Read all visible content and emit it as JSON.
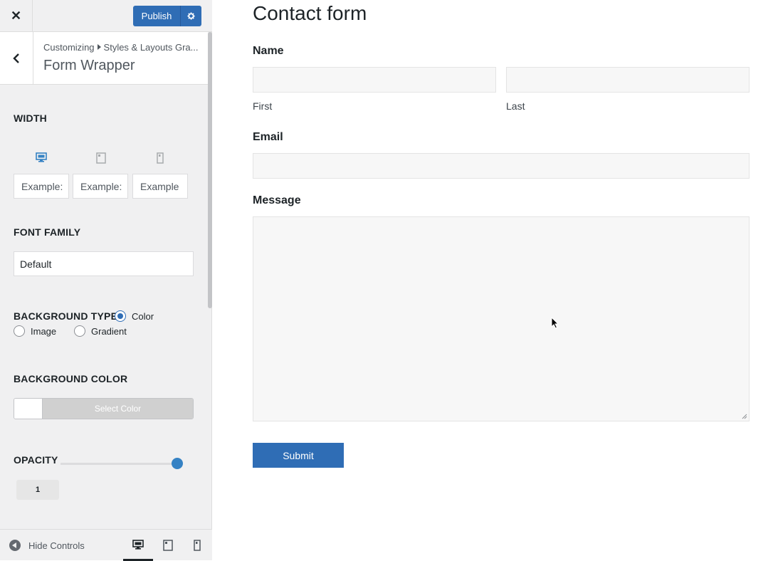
{
  "topbar": {
    "close_label": "✕",
    "publish_label": "Publish"
  },
  "header": {
    "breadcrumb_root": "Customizing",
    "breadcrumb_child": "Styles & Layouts Gra...",
    "title": "Form Wrapper"
  },
  "width": {
    "label": "WIDTH",
    "inputs": [
      {
        "placeholder": "Example:"
      },
      {
        "placeholder": "Example:"
      },
      {
        "placeholder": "Example"
      }
    ]
  },
  "font_family": {
    "label": "FONT FAMILY",
    "value": "Default"
  },
  "background_type": {
    "label": "BACKGROUND TYPE",
    "options": [
      {
        "label": "Color",
        "selected": true
      },
      {
        "label": "Image",
        "selected": false
      },
      {
        "label": "Gradient",
        "selected": false
      }
    ]
  },
  "background_color": {
    "label": "BACKGROUND COLOR",
    "button_label": "Select Color"
  },
  "opacity": {
    "label": "OPACITY",
    "value": "1",
    "level": 1
  },
  "footer": {
    "hide_controls": "Hide Controls"
  },
  "form": {
    "title": "Contact form",
    "name_label": "Name",
    "first_label": "First",
    "last_label": "Last",
    "email_label": "Email",
    "message_label": "Message",
    "submit_label": "Submit"
  },
  "colors": {
    "accent": "#2f6db5",
    "slider": "#3582c4"
  }
}
